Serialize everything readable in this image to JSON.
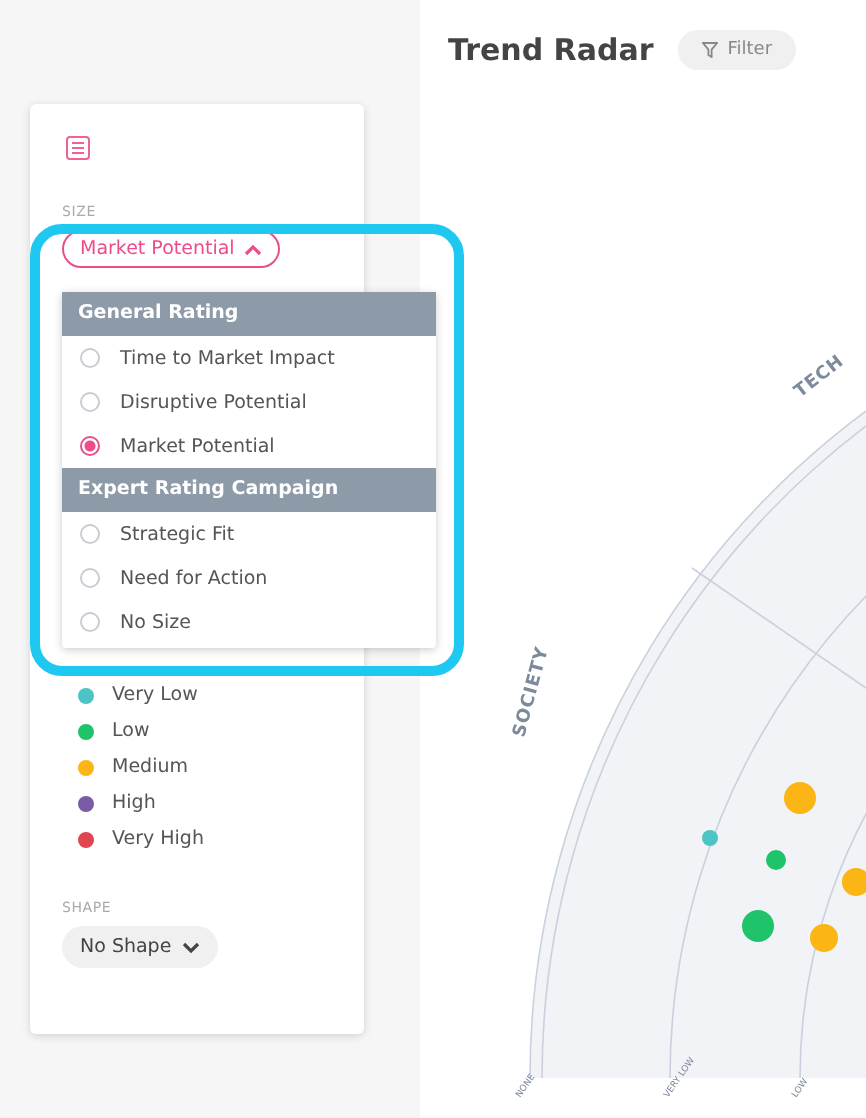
{
  "sidebar": {
    "size": {
      "label": "SIZE",
      "value": "Market Potential",
      "expanded": true
    },
    "size_menu": [
      {
        "title": "General Rating",
        "options": [
          {
            "label": "Time to Market Impact",
            "selected": false
          },
          {
            "label": "Disruptive Potential",
            "selected": false
          },
          {
            "label": "Market Potential",
            "selected": true
          }
        ]
      },
      {
        "title": "Expert Rating Campaign",
        "options": [
          {
            "label": "Strategic Fit",
            "selected": false
          },
          {
            "label": "Need for Action",
            "selected": false
          },
          {
            "label": "No Size",
            "selected": false
          }
        ]
      }
    ],
    "color_legend": [
      {
        "label": "Very Low",
        "color": "#4cc4c4"
      },
      {
        "label": "Low",
        "color": "#1fc46a"
      },
      {
        "label": "Medium",
        "color": "#fbb514"
      },
      {
        "label": "High",
        "color": "#7a5ca6"
      },
      {
        "label": "Very High",
        "color": "#e0464f"
      }
    ],
    "shape": {
      "label": "SHAPE",
      "value": "No Shape",
      "expanded": false
    }
  },
  "main": {
    "title": "Trend Radar",
    "filter_button": "Filter",
    "radar": {
      "segments": [
        "TECH",
        "SOCIETY"
      ],
      "rings": [
        "NONE",
        "VERY LOW",
        "LOW"
      ]
    }
  }
}
